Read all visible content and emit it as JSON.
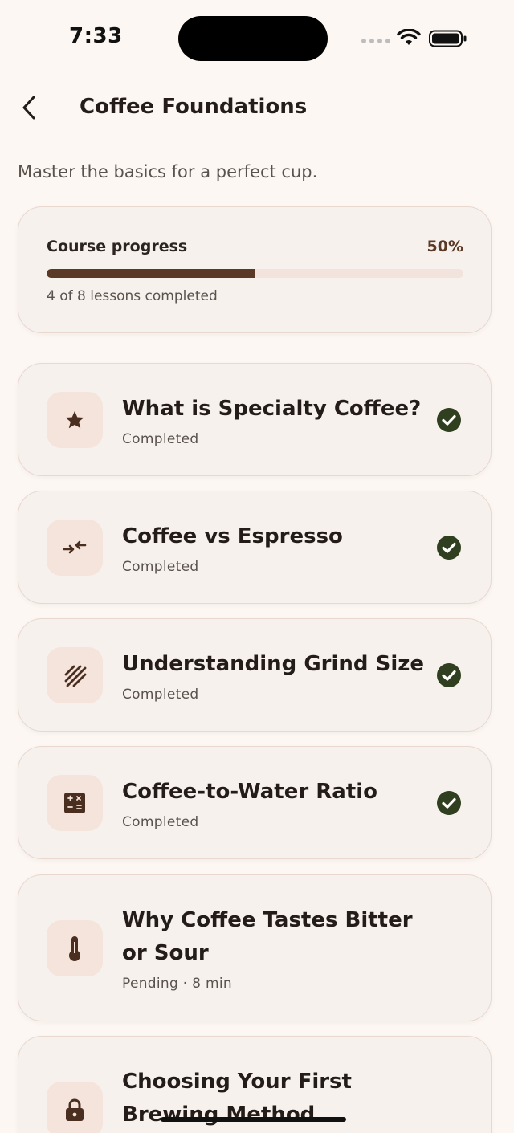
{
  "status_bar": {
    "time": "7:33"
  },
  "header": {
    "title": "Coffee Foundations"
  },
  "subtitle": "Master the basics for a perfect cup.",
  "progress": {
    "label": "Course progress",
    "percent_text": "50%",
    "fraction": 0.5,
    "count_text": "4 of 8 lessons completed"
  },
  "lessons": [
    {
      "title": "What is Specialty Coffee?",
      "status": "Completed",
      "icon": "star-icon"
    },
    {
      "title": "Coffee vs Espresso",
      "status": "Completed",
      "icon": "compare-arrows-icon"
    },
    {
      "title": "Understanding Grind Size",
      "status": "Completed",
      "icon": "texture-icon"
    },
    {
      "title": "Coffee-to-Water Ratio",
      "status": "Completed",
      "icon": "calculator-icon"
    },
    {
      "title": "Why Coffee Tastes Bitter or Sour",
      "status": "Pending · 8 min",
      "icon": "thermometer-icon"
    },
    {
      "title": "Choosing Your First Brewing Method",
      "status": "",
      "icon": "lock-icon"
    }
  ],
  "colors": {
    "accent": "#5a3a26",
    "check": "#2f3f1f",
    "background": "#fcf7f3",
    "card": "#f6f1ec",
    "icon_tile": "#f5e4dc"
  }
}
